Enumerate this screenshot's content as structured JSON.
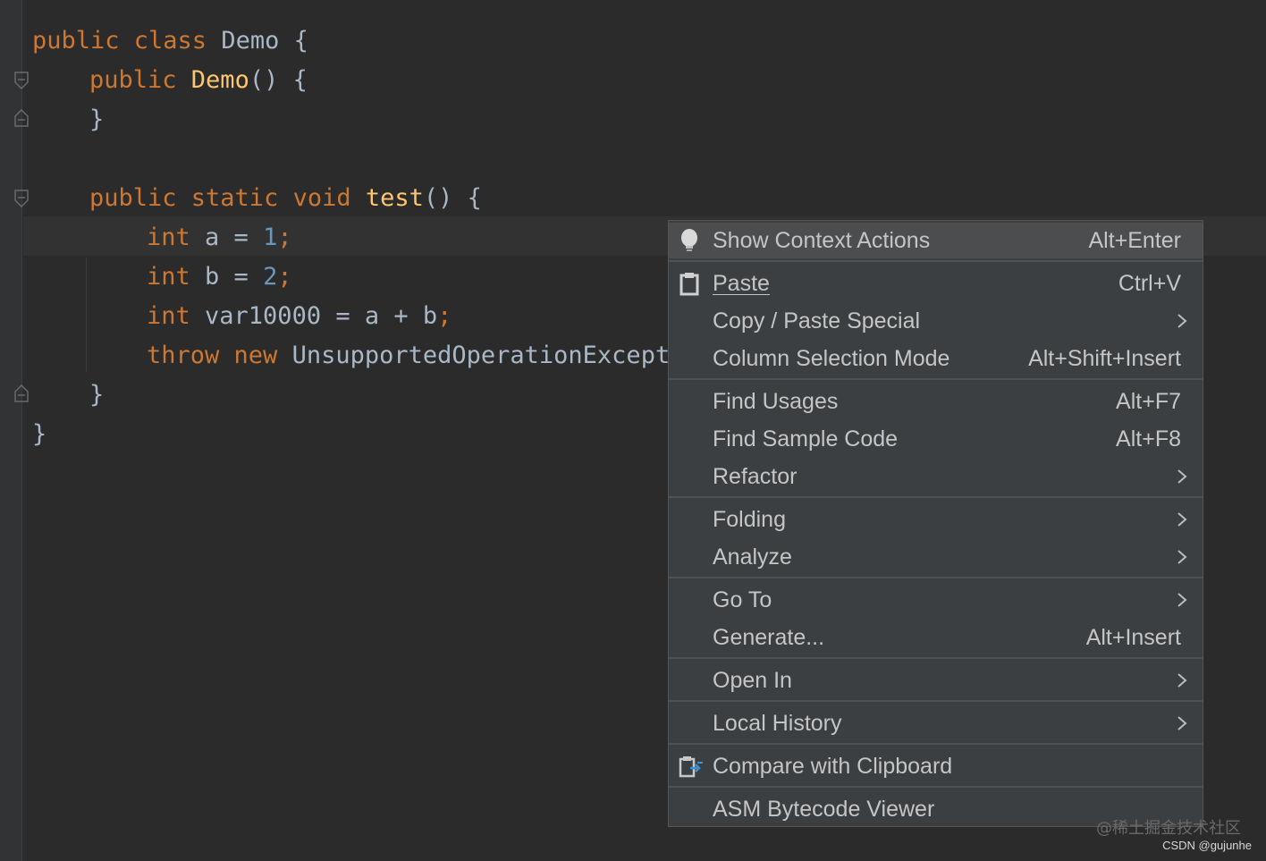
{
  "editor": {
    "lines": [
      {
        "tokens": [
          {
            "t": "public class ",
            "c": "kw"
          },
          {
            "t": "Demo {",
            "c": "plain"
          }
        ]
      },
      {
        "tokens": [
          {
            "t": "public ",
            "c": "kw"
          },
          {
            "t": "Demo",
            "c": "fn"
          },
          {
            "t": "() {",
            "c": "plain"
          }
        ]
      },
      {
        "tokens": [
          {
            "t": "}",
            "c": "plain"
          }
        ]
      },
      {
        "tokens": [
          {
            "t": "public static void ",
            "c": "kw"
          },
          {
            "t": "test",
            "c": "fn"
          },
          {
            "t": "() {",
            "c": "plain"
          }
        ]
      },
      {
        "tokens": [
          {
            "t": "int ",
            "c": "kw"
          },
          {
            "t": "a = ",
            "c": "plain"
          },
          {
            "t": "1",
            "c": "num"
          },
          {
            "t": ";",
            "c": "kw"
          }
        ]
      },
      {
        "tokens": [
          {
            "t": "int ",
            "c": "kw"
          },
          {
            "t": "b = ",
            "c": "plain"
          },
          {
            "t": "2",
            "c": "num"
          },
          {
            "t": ";",
            "c": "kw"
          }
        ]
      },
      {
        "tokens": [
          {
            "t": "int ",
            "c": "kw"
          },
          {
            "t": "var10000 = a + b",
            "c": "plain"
          },
          {
            "t": ";",
            "c": "kw"
          }
        ]
      },
      {
        "tokens": [
          {
            "t": "throw new ",
            "c": "kw"
          },
          {
            "t": "UnsupportedOperationExcepti",
            "c": "plain"
          }
        ]
      },
      {
        "tokens": [
          {
            "t": "}",
            "c": "plain"
          }
        ]
      },
      {
        "tokens": [
          {
            "t": "}",
            "c": "plain"
          }
        ]
      }
    ]
  },
  "context_menu": {
    "items": [
      {
        "label": "Show Context Actions",
        "shortcut": "Alt+Enter",
        "icon": "lightbulb-icon"
      },
      {
        "label": "Paste",
        "shortcut": "Ctrl+V",
        "icon": "clipboard-icon"
      },
      {
        "label": "Copy / Paste Special",
        "shortcut": "",
        "submenu": true
      },
      {
        "label": "Column Selection Mode",
        "shortcut": "Alt+Shift+Insert"
      },
      {
        "label": "Find Usages",
        "shortcut": "Alt+F7"
      },
      {
        "label": "Find Sample Code",
        "shortcut": "Alt+F8"
      },
      {
        "label": "Refactor",
        "shortcut": "",
        "submenu": true
      },
      {
        "label": "Folding",
        "shortcut": "",
        "submenu": true
      },
      {
        "label": "Analyze",
        "shortcut": "",
        "submenu": true
      },
      {
        "label": "Go To",
        "shortcut": "",
        "submenu": true
      },
      {
        "label": "Generate...",
        "shortcut": "Alt+Insert"
      },
      {
        "label": "Open In",
        "shortcut": "",
        "submenu": true
      },
      {
        "label": "Local History",
        "shortcut": "",
        "submenu": true
      },
      {
        "label": "Compare with Clipboard",
        "shortcut": "",
        "icon": "compare-icon"
      },
      {
        "label": "ASM Bytecode Viewer",
        "shortcut": ""
      }
    ]
  },
  "watermark": {
    "line1": "@稀土掘金技术社区",
    "line2": "CSDN @gujunhe"
  },
  "colors": {
    "keyword": "#cc7832",
    "function": "#ffc66d",
    "number": "#6897bb",
    "text": "#a9b7c6",
    "menu_bg": "#3c3f41"
  }
}
